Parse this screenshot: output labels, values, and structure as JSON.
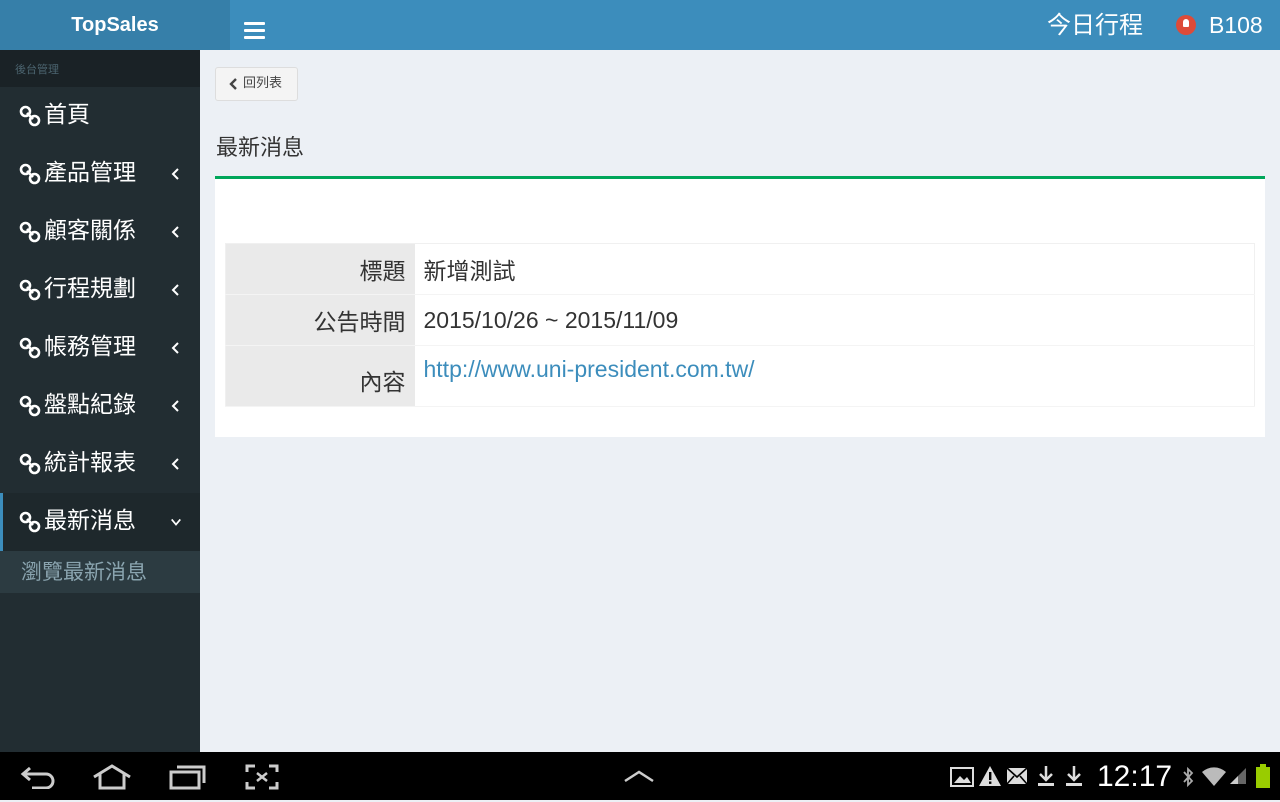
{
  "header": {
    "app_title": "TopSales",
    "today_schedule": "今日行程",
    "user": "B108"
  },
  "sidebar": {
    "section_label": "後台管理",
    "items": [
      {
        "label": "首頁"
      },
      {
        "label": "產品管理"
      },
      {
        "label": "顧客關係"
      },
      {
        "label": "行程規劃"
      },
      {
        "label": "帳務管理"
      },
      {
        "label": "盤點紀錄"
      },
      {
        "label": "統計報表"
      },
      {
        "label": "最新消息"
      }
    ],
    "sub_items": [
      {
        "label": "瀏覽最新消息"
      }
    ]
  },
  "content": {
    "back_label": "回列表",
    "page_title": "最新消息",
    "fields": [
      {
        "label": "標題",
        "value": "新增測試"
      },
      {
        "label": "公告時間",
        "value": "2015/10/26 ~ 2015/11/09"
      },
      {
        "label": "內容",
        "value": "http://www.uni-president.com.tw/"
      }
    ]
  },
  "system_bar": {
    "time": "12:17"
  },
  "colors": {
    "header": "#3c8dbc",
    "logo_bg": "#367fa9",
    "sidebar_bg": "#222d32",
    "box_accent": "#00a65a",
    "link": "#3c8dbc"
  }
}
